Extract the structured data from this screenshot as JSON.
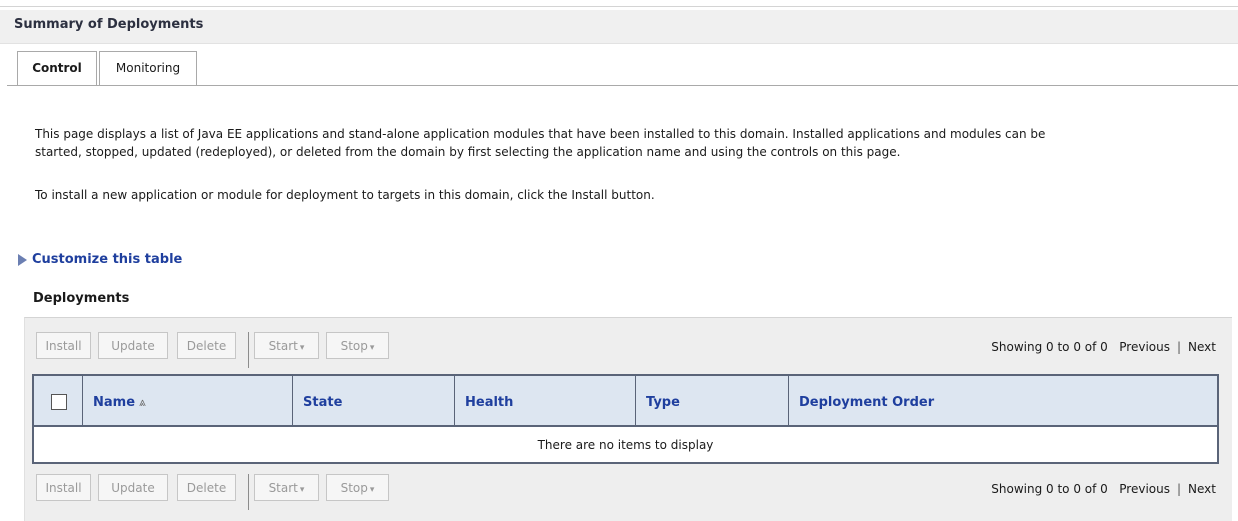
{
  "summary": {
    "title": "Summary of Deployments"
  },
  "tabs": [
    {
      "label": "Control",
      "active": true
    },
    {
      "label": "Monitoring",
      "active": false
    }
  ],
  "description": {
    "line1": "This page displays a list of Java EE applications and stand-alone application modules that have been installed to this domain. Installed applications and modules can be",
    "line2": "started, stopped, updated (redeployed), or deleted from the domain by first selecting the application name and using the controls on this page.",
    "line3": "To install a new application or module for deployment to targets in this domain, click the Install button."
  },
  "customize": {
    "label": "Customize this table",
    "icon": "expand-triangle-icon"
  },
  "deployments": {
    "title": "Deployments",
    "toolbar": {
      "install": "Install",
      "update": "Update",
      "delete": "Delete",
      "start": "Start",
      "stop": "Stop"
    },
    "paging": {
      "showing": "Showing 0 to 0 of 0",
      "previous": "Previous",
      "separator": "|",
      "next": "Next"
    },
    "table": {
      "columns": [
        "Name",
        "State",
        "Health",
        "Type",
        "Deployment Order"
      ],
      "sort_icon": "⩓",
      "empty_message": "There are no items to display"
    }
  },
  "colors": {
    "link_blue": "#1f3f9e",
    "header_bg": "#dde6f1",
    "panel_bg": "#eeeeee",
    "disabled_text": "#9a9a9a"
  }
}
